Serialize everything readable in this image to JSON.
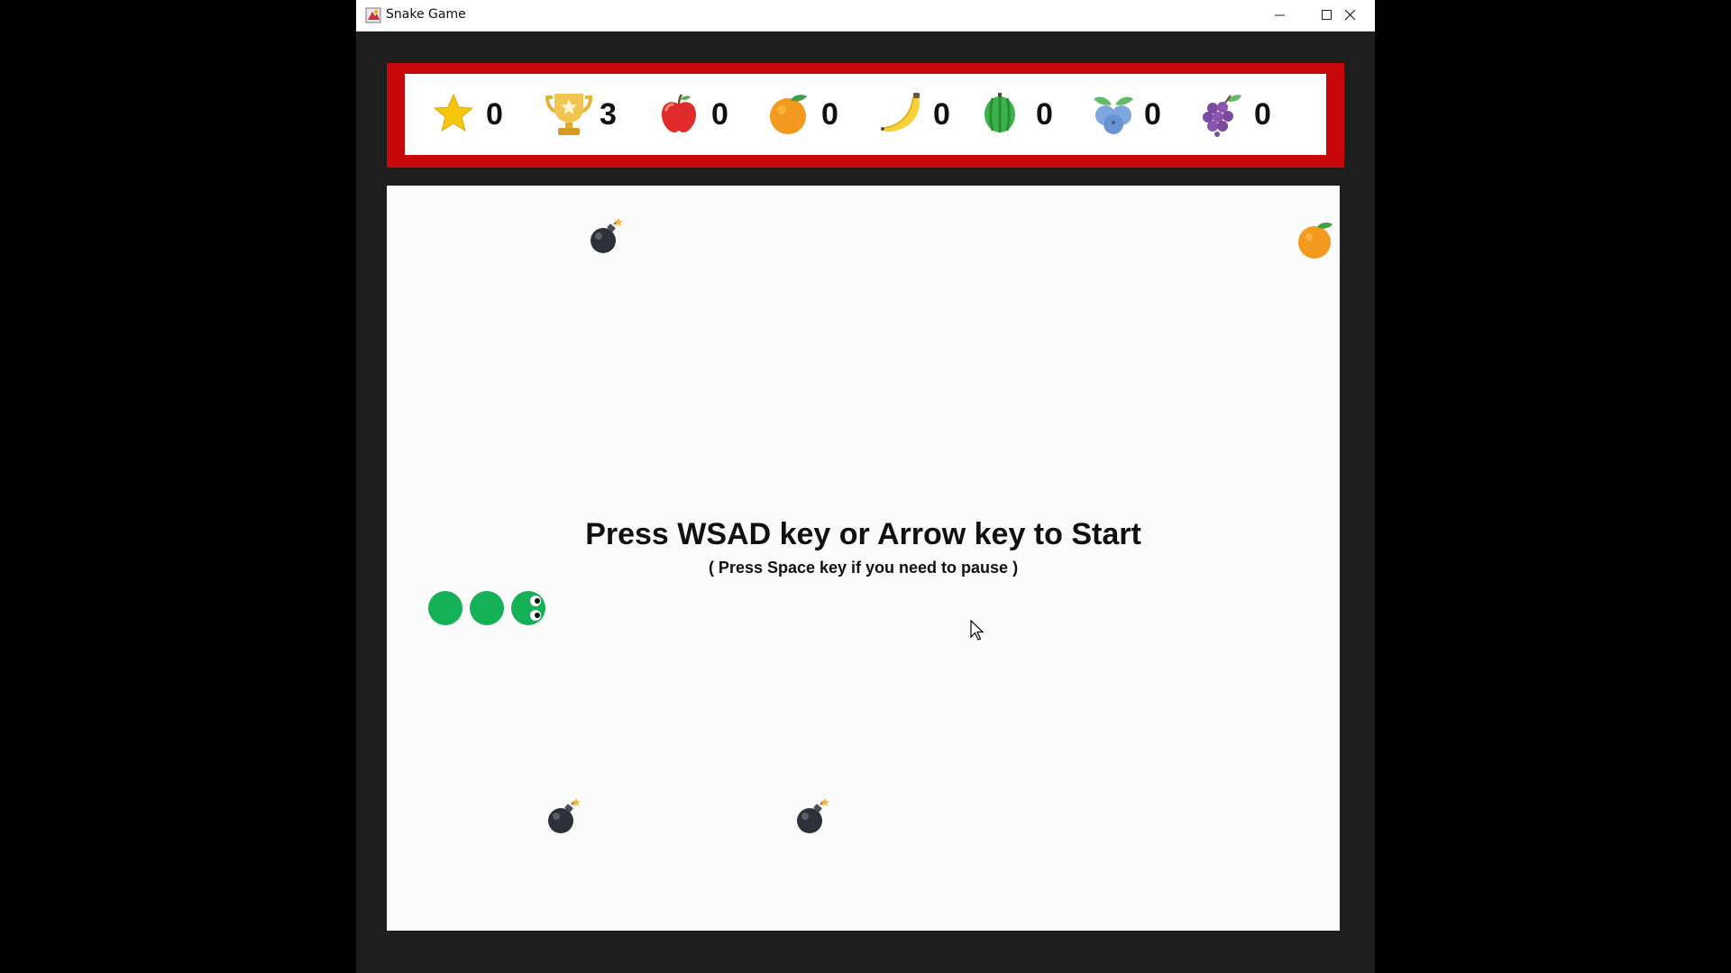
{
  "window": {
    "title": "Snake Game"
  },
  "scoreboard": {
    "items": [
      {
        "icon": "star-icon",
        "value": "0"
      },
      {
        "icon": "trophy-icon",
        "value": "3"
      },
      {
        "icon": "apple-icon",
        "value": "0"
      },
      {
        "icon": "orange-icon",
        "value": "0"
      },
      {
        "icon": "banana-icon",
        "value": "0"
      },
      {
        "icon": "watermelon-icon",
        "value": "0"
      },
      {
        "icon": "blueberry-icon",
        "value": "0"
      },
      {
        "icon": "grape-icon",
        "value": "0"
      }
    ]
  },
  "board": {
    "start_message": "Press WSAD key or Arrow key to Start",
    "pause_message": "( Press Space key if you need to pause )",
    "snake_length": 3,
    "bomb_count": 3,
    "food": [
      "orange"
    ]
  },
  "colors": {
    "scorebar_border": "#c8070b",
    "snake": "#14b157",
    "board_background": "#fbfbfb",
    "frame_background": "#1e1e1e"
  }
}
